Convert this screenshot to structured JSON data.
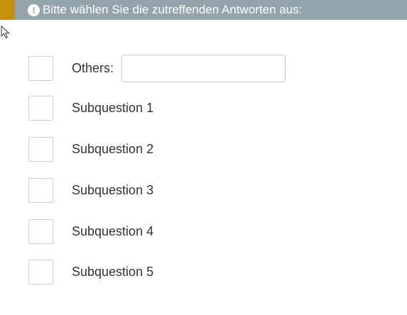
{
  "alert": {
    "icon": "exclamation-circle-icon",
    "text": "Bitte wählen Sie die zutreffenden Antworten aus:"
  },
  "colors": {
    "accent": "#c78f0b",
    "alert_background": "#94a4ab",
    "text": "#333333"
  },
  "options": {
    "others_label": "Others:",
    "others_value": "",
    "items": [
      {
        "label": "Subquestion 1",
        "checked": false
      },
      {
        "label": "Subquestion 2",
        "checked": false
      },
      {
        "label": "Subquestion 3",
        "checked": false
      },
      {
        "label": "Subquestion 4",
        "checked": false
      },
      {
        "label": "Subquestion 5",
        "checked": false
      }
    ]
  }
}
